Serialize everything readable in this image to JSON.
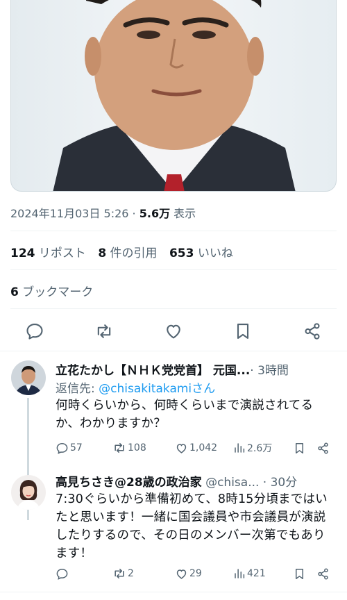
{
  "tweet": {
    "date": "2024年11月03日 5:26",
    "dot": " · ",
    "views_count": "5.6万",
    "views_label": " 表示",
    "reposts_count": "124",
    "reposts_label": " リポスト",
    "quotes_count": "8",
    "quotes_label": " 件の引用",
    "likes_count": "653",
    "likes_label": " いいね",
    "bookmarks_count": "6",
    "bookmarks_label": " ブックマーク"
  },
  "action_icons": [
    "reply-icon",
    "repost-icon",
    "like-icon",
    "bookmark-icon",
    "share-icon"
  ],
  "replies": [
    {
      "name": "立花たかし【ＮＨＫ党党首】 元国...",
      "handle": "",
      "time": "· 3時間",
      "reply_to_prefix": "返信先: ",
      "reply_to_handle": "@chisakitakamiさん",
      "text": "何時くらいから、何時くらいまで演説されてるか、わかりますか？",
      "replies": "57",
      "reposts": "108",
      "likes": "1,042",
      "views": "2.6万"
    },
    {
      "name": "高見ちさき@28歳の政治家",
      "handle": " @chisa...",
      "time": " · 30分",
      "text": "7:30ぐらいから準備初めて、8時15分頃まではいたと思います！一緒に国会議員や市会議員が演説したりするので、その日のメンバー次第でもあります！",
      "replies": "",
      "reposts": "2",
      "likes": "29",
      "views": "421"
    }
  ],
  "colors": {
    "text": "#0f1419",
    "secondary": "#536471",
    "link": "#1d9bf0",
    "divider": "#eff3f4"
  }
}
